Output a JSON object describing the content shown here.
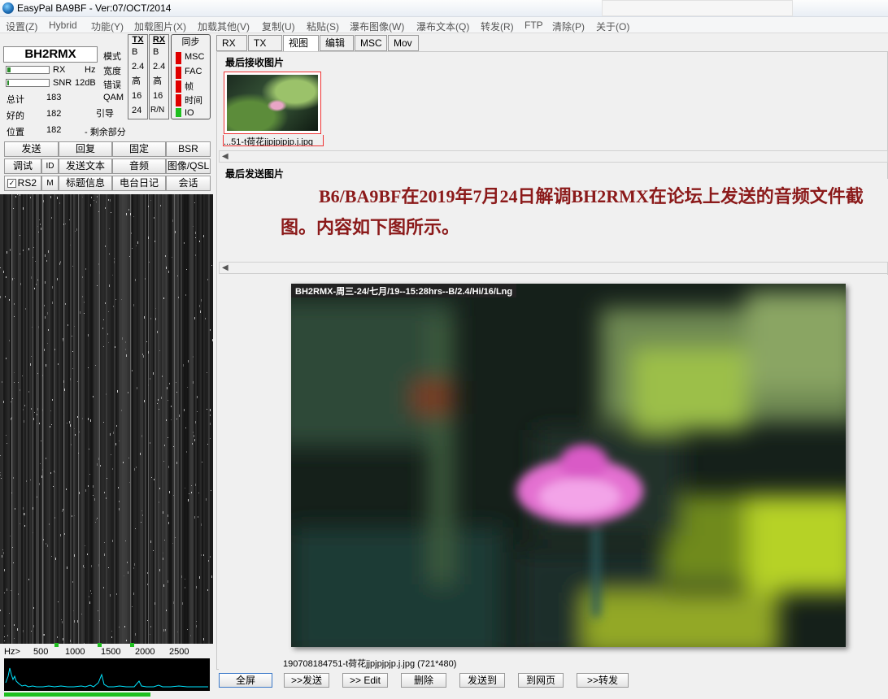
{
  "window": {
    "title": "EasyPal  BA9BF - Ver:07/OCT/2014"
  },
  "menu": [
    "设置(Z)",
    "Hybrid",
    "功能(Y)",
    "加载图片(X)",
    "加载其他(V)",
    "复制(U)",
    "粘贴(S)",
    "瀑布图像(W)",
    "瀑布文本(Q)",
    "转发(R)",
    "FTP",
    "清除(P)",
    "关于(O)"
  ],
  "status": {
    "callsign": "BH2RMX",
    "rx_label": "RX",
    "hz_label": "Hz",
    "snr_label": "SNR",
    "snr_value": "12dB",
    "stats": [
      {
        "label": "总计",
        "value": "183"
      },
      {
        "label": "好的",
        "value": "182"
      },
      {
        "label": "位置",
        "value": "182"
      }
    ],
    "remaining_label": "- 剩余部分",
    "qam_label": "QAM",
    "pilot_label": "引导",
    "mode_labels": [
      "模式",
      "宽度",
      "错误",
      "QAM",
      "引导"
    ]
  },
  "tx_column": {
    "header": "TX",
    "values": [
      "B",
      "2.4",
      "高",
      "16",
      "24"
    ]
  },
  "rx_column": {
    "header": "RX",
    "values": [
      "B",
      "2.4",
      "高",
      "16",
      "R/N"
    ]
  },
  "sync": {
    "header": "同步",
    "items": [
      {
        "label": "MSC",
        "state": "red"
      },
      {
        "label": "FAC",
        "state": "red"
      },
      {
        "label": "帧",
        "state": "red"
      },
      {
        "label": "时间",
        "state": "red"
      },
      {
        "label": "IO",
        "state": "green"
      }
    ]
  },
  "buttons": {
    "row1": [
      "发送",
      "回复",
      "固定",
      "BSR"
    ],
    "row2": [
      "调试",
      "ID",
      "发送文本",
      "音频",
      "图像/QSL"
    ],
    "row3": [
      "RS2",
      "M",
      "标题信息",
      "电台日记",
      "会话"
    ]
  },
  "waterfall": {
    "axis_labels": [
      "Hz>",
      "500",
      "1000",
      "1500",
      "2000",
      "2500"
    ]
  },
  "tabs": [
    "RX",
    "TX",
    "视图",
    "编辑",
    "MSC",
    "Mov"
  ],
  "active_tab": "视图",
  "received": {
    "title": "最后接收图片",
    "thumb_label": "...51-t荷花jjpjpjpjp.j.jpg"
  },
  "sent": {
    "title": "最后发送图片"
  },
  "annotation": {
    "text": "B6/BA9BF在2019年7月24日解调BH2RMX在论坛上发送的音频文件截图。内容如下图所示。"
  },
  "image": {
    "header": "BH2RMX-周三-24/七月/19--15:28hrs--B/2.4/Hi/16/Lng",
    "caption": "190708184751-t荷花jjpjpjpjp.j.jpg   (721*480)"
  },
  "bottom_buttons": [
    "全屏",
    ">>发送",
    ">> Edit",
    "删除",
    "发送到",
    "到网页",
    ">>转发"
  ],
  "colors": {
    "led_red": "#e00000",
    "led_green": "#1fbf1f",
    "annotation": "#8b1a1a",
    "selection": "#e33333"
  }
}
